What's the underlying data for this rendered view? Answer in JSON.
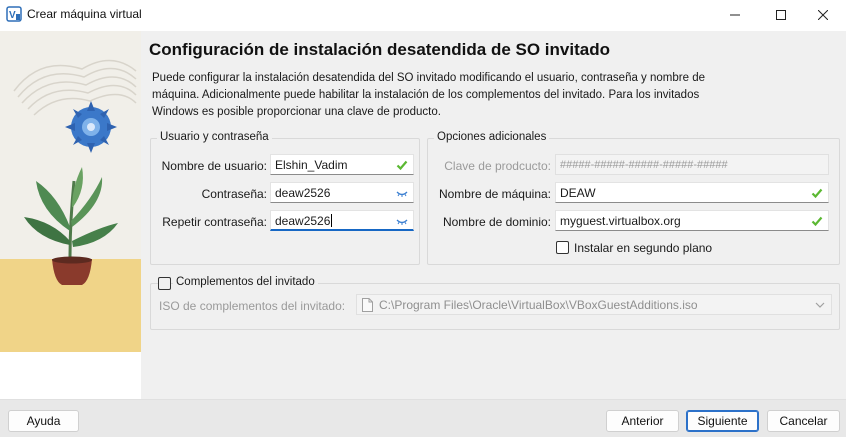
{
  "window": {
    "title": "Crear máquina virtual",
    "controls": [
      "minimize-icon",
      "maximize-icon",
      "close-icon"
    ]
  },
  "page": {
    "title": "Configuración de instalación desatendida de SO invitado",
    "description": "Puede configurar la instalación desatendida del SO invitado modificando el usuario, contraseña y nombre de máquina. Adicionalmente puede habilitar la instalación de los complementos del invitado. Para los invitados Windows es posible proporcionar una clave de producto."
  },
  "user_group": {
    "title": "Usuario y contraseña",
    "username_label": "Nombre de usuario:",
    "username_value": "Elshin_Vadim",
    "password_label": "Contraseña:",
    "password_value": "deaw2526",
    "repeat_label": "Repetir contraseña:",
    "repeat_value": "deaw2526"
  },
  "options_group": {
    "title": "Opciones adicionales",
    "product_key_label": "Clave de prodcucto:",
    "product_key_placeholder": "#####-#####-#####-#####-#####",
    "hostname_label": "Nombre de máquina:",
    "hostname_value": "DEAW",
    "domain_label": "Nombre de dominio:",
    "domain_value": "myguest.virtualbox.org",
    "background_label": "Instalar en segundo plano",
    "background_checked": false
  },
  "guest_additions": {
    "title": "Complementos del invitado",
    "checked": false,
    "iso_label": "ISO de complementos del invitado:",
    "iso_value": "C:\\Program Files\\Oracle\\VirtualBox\\VBoxGuestAdditions.iso"
  },
  "footer": {
    "help": "Ayuda",
    "back": "Anterior",
    "next": "Siguiente",
    "cancel": "Cancelar"
  },
  "colors": {
    "valid_check": "#5bb832",
    "eye_icon": "#3b7fd1",
    "accent": "#1667c4"
  }
}
